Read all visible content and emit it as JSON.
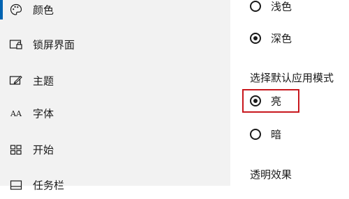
{
  "sidebar": {
    "items": [
      {
        "label": "颜色",
        "icon": "palette-icon"
      },
      {
        "label": "锁屏界面",
        "icon": "lock-screen-icon"
      },
      {
        "label": "主题",
        "icon": "theme-brush-icon"
      },
      {
        "label": "字体",
        "icon": "font-icon"
      },
      {
        "label": "开始",
        "icon": "start-tiles-icon"
      },
      {
        "label": "任务栏",
        "icon": "taskbar-icon"
      }
    ]
  },
  "windows_mode": {
    "options": [
      {
        "label": "浅色",
        "checked": false
      },
      {
        "label": "深色",
        "checked": true
      }
    ]
  },
  "app_mode": {
    "title": "选择默认应用模式",
    "options": [
      {
        "label": "亮",
        "checked": true
      },
      {
        "label": "暗",
        "checked": false
      }
    ]
  },
  "transparency": {
    "title": "透明效果"
  },
  "colors": {
    "accent": "#0063b1",
    "highlight": "#c8171d",
    "sidebar_bg": "#f2f2f2"
  },
  "font_icon_glyph": "AA"
}
